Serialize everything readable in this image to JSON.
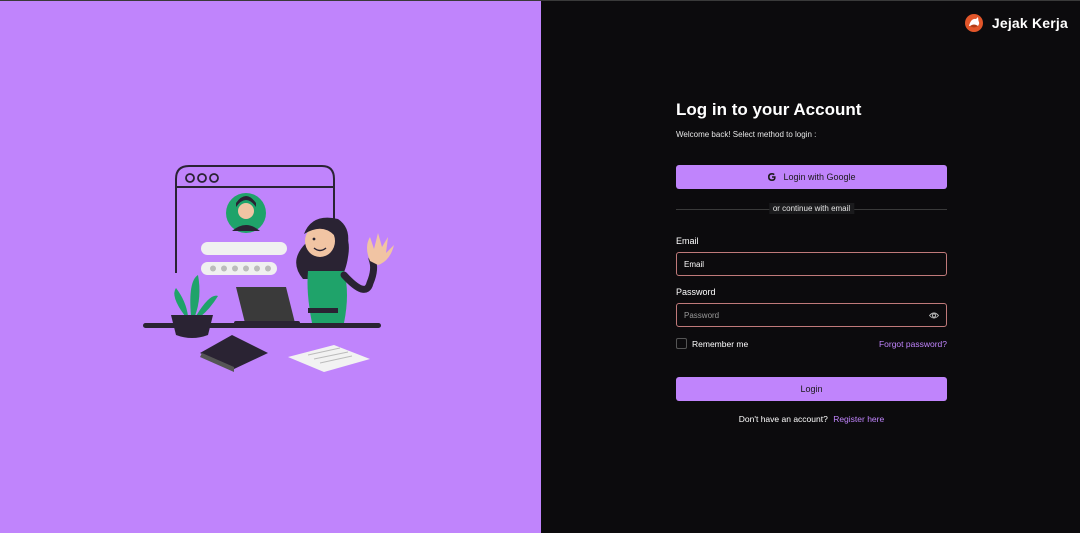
{
  "brand": {
    "name": "Jejak Kerja",
    "logo_icon": "fox-logo-icon",
    "logo_color": "#e2562a"
  },
  "colors": {
    "accent": "#c084fc",
    "panel_bg": "#0c0b0d",
    "field_border": "#c07a7a"
  },
  "login": {
    "title": "Log in to your Account",
    "subtitle": "Welcome back! Select method to login :",
    "google_button": "Login with Google",
    "divider_text": "or continue with email",
    "email_label": "Email",
    "email_placeholder": "Email",
    "password_label": "Password",
    "password_placeholder": "Password",
    "remember_label": "Remember me",
    "forgot_link": "Forgot password?",
    "login_button": "Login",
    "register_prompt": "Don't have an account?",
    "register_link": "Register here"
  }
}
